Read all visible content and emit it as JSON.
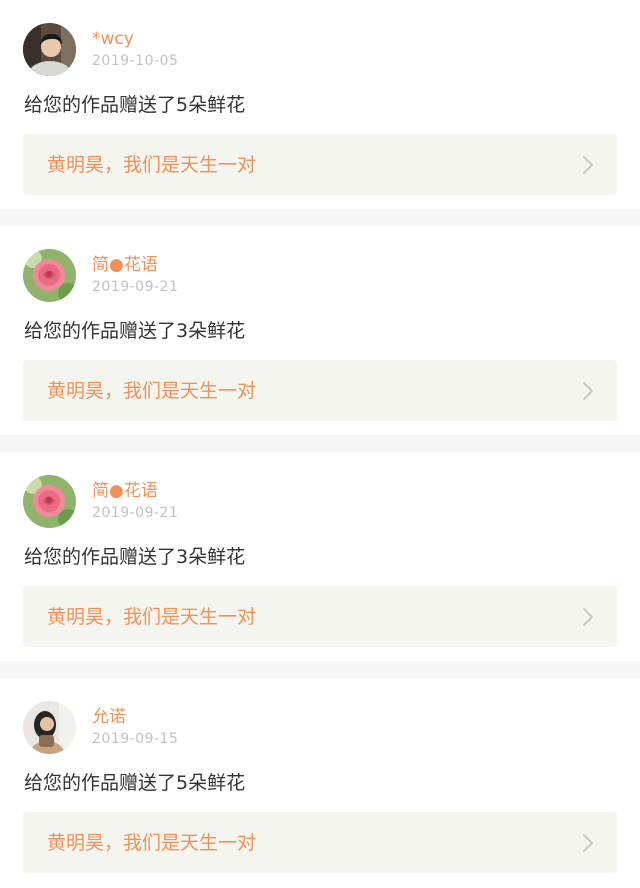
{
  "notifications": [
    {
      "user_name": "*wcy",
      "date": "2019-10-05",
      "avatar_icon": "boy-portrait-icon",
      "message": "给您的作品赠送了5朵鲜花",
      "work_title": "黄明昊，我们是天生一对"
    },
    {
      "user_name": "简●花语",
      "date": "2019-09-21",
      "avatar_icon": "pink-rose-icon",
      "message": "给您的作品赠送了3朵鲜花",
      "work_title": "黄明昊，我们是天生一对"
    },
    {
      "user_name": "简●花语",
      "date": "2019-09-21",
      "avatar_icon": "pink-rose-icon",
      "message": "给您的作品赠送了3朵鲜花",
      "work_title": "黄明昊，我们是天生一对"
    },
    {
      "user_name": "允诺",
      "date": "2019-09-15",
      "avatar_icon": "girl-portrait-icon",
      "message": "给您的作品赠送了5朵鲜花",
      "work_title": "黄明昊，我们是天生一对"
    }
  ],
  "colors": {
    "accent": "#f0915a",
    "text": "#333333",
    "muted": "#c2c2c2",
    "link_bg": "#f5f5ef",
    "divider": "#f7f7f7"
  },
  "icons": {
    "chevron": "chevron-right-icon"
  }
}
